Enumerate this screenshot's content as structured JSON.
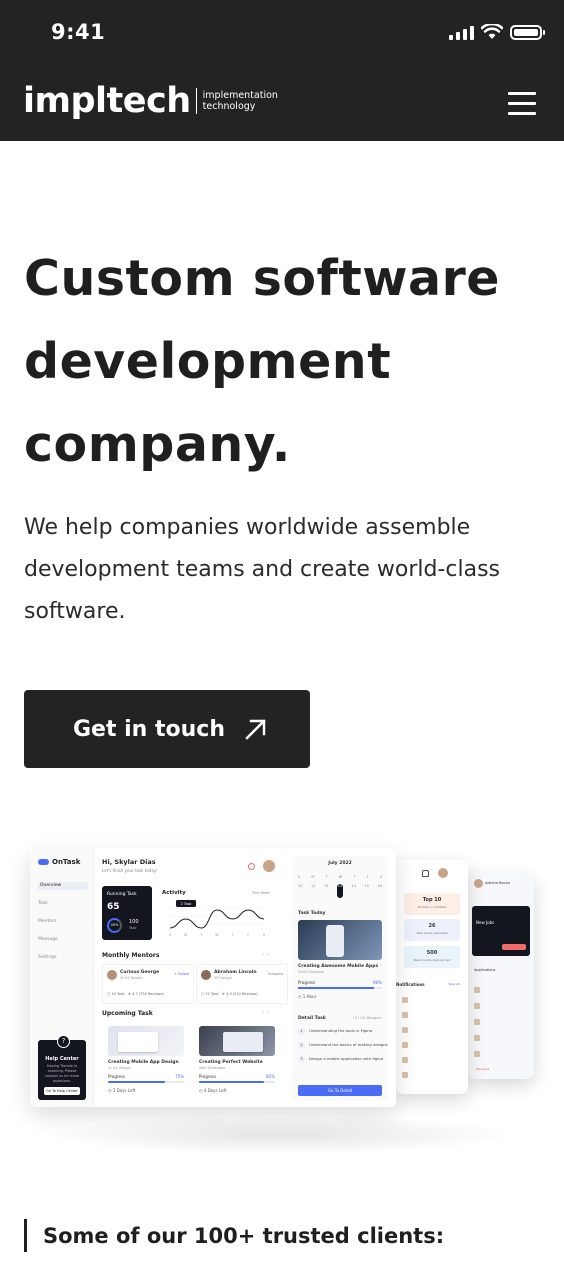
{
  "status_bar": {
    "time": "9:41"
  },
  "header": {
    "logo_word": "impltech",
    "logo_tagline_1": "implementation",
    "logo_tagline_2": "technology",
    "menu_icon": "hamburger-menu-icon"
  },
  "hero": {
    "title": "Custom software development company.",
    "subtitle": "We help companies worldwide assemble development teams and create world-class software.",
    "cta_label": "Get in touch",
    "cta_icon": "arrow-up-right-icon"
  },
  "mockup": {
    "brand": "OnTask",
    "nav": [
      "Overview",
      "Task",
      "Mentors",
      "Message",
      "Settings"
    ],
    "greeting": "Hi, Skylar Dias",
    "greeting_sub": "Let's finish your task today!",
    "running_task_label": "Running Task",
    "running_task_value": "65",
    "running_task_percent": "45%",
    "running_task_total": "100",
    "running_task_total_label": "Task",
    "activity_label": "Activity",
    "activity_range": "This Week",
    "activity_tooltip": "2 Task",
    "activity_points": [
      1,
      2,
      1,
      3,
      2,
      3,
      2
    ],
    "activity_days": [
      "S",
      "M",
      "T",
      "W",
      "T",
      "F",
      "S"
    ],
    "mentors_title": "Monthly Mentors",
    "mentors": [
      {
        "name": "Curious George",
        "role": "UI UX Design",
        "action": "+ Follow",
        "tasks": "40 Task",
        "rating": "4,7 (750 Reviews)"
      },
      {
        "name": "Abraham Lincoln",
        "role": "3D Design",
        "action": "Followed",
        "tasks": "32 Task",
        "rating": "4,9 (510 Reviews)"
      }
    ],
    "upcoming_title": "Upcoming Task",
    "upcoming": [
      {
        "name": "Creating Mobile App Design",
        "category": "UI UX Design",
        "progress_label": "Progress",
        "progress_text": "75%",
        "progress": 0.75,
        "left": "3 Days Left"
      },
      {
        "name": "Creating Perfect Website",
        "category": "Web Developer",
        "progress_label": "Progress",
        "progress_text": "85%",
        "progress": 0.85,
        "left": "4 Days Left"
      }
    ],
    "help": {
      "title": "Help Center",
      "text": "Having Trouble in Learning. Please contact us for more questions.",
      "button": "Go To Help Center"
    },
    "calendar": {
      "month": "July 2022",
      "weekdays": [
        "S",
        "M",
        "T",
        "W",
        "T",
        "F",
        "S"
      ],
      "dates": [
        "10",
        "11",
        "12",
        "13",
        "14",
        "15",
        "16"
      ]
    },
    "task_today": {
      "title": "Task Today",
      "name": "Creating Awesome Mobile Apps",
      "category": "UI/UX Designer",
      "progress_label": "Progress",
      "progress_text": "90%",
      "progress": 0.9,
      "time": "1 Hour"
    },
    "detail_task": {
      "title": "Detail Task",
      "meta": "UI / UX Designer",
      "steps": [
        "Understanding the tools in Figma",
        "Understand the basics of making designs",
        "Design a mobile application with figma"
      ],
      "button": "Go To Detail"
    },
    "phone_1": {
      "cards": [
        {
          "title": "Top 10",
          "sub": "Position in dribbble"
        },
        {
          "title": "26",
          "sub": "New Items Uploaded"
        },
        {
          "title": "500",
          "sub": "New Clients Approached"
        }
      ],
      "notifications_title": "Notifications",
      "view_all": "View All"
    },
    "phone_2": {
      "user": "Adeline Bacon",
      "new_jobs": "New Jobs",
      "applications": "Applications",
      "status": "Declined"
    }
  },
  "clients": {
    "heading": "Some of our 100+ trusted clients:"
  }
}
